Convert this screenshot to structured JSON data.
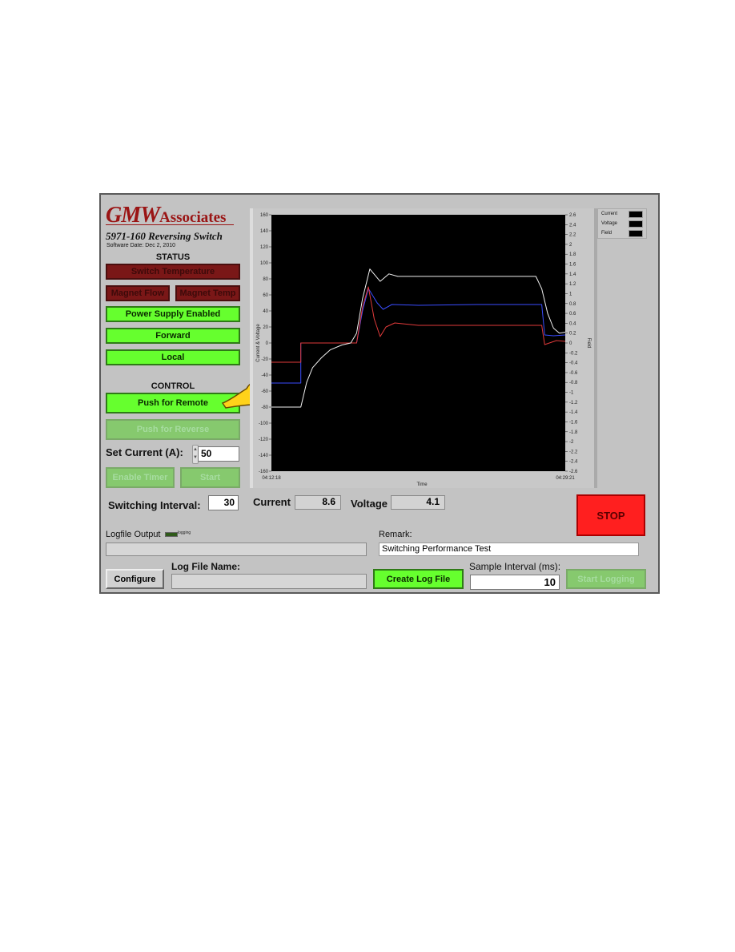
{
  "header": {
    "brand_main": "GMW",
    "brand_suffix": "Associates",
    "product_title": "5971-160 Reversing Switch",
    "software_date": "Software Date: Dec 2, 2010"
  },
  "status": {
    "title": "STATUS",
    "indicators": [
      {
        "label": "Switch Temperature",
        "state": "off"
      },
      {
        "label": "Magnet Flow",
        "state": "off"
      },
      {
        "label": "Magnet Temp",
        "state": "off"
      },
      {
        "label": "Power Supply Enabled",
        "state": "on"
      },
      {
        "label": "Forward",
        "state": "on"
      },
      {
        "label": "Local",
        "state": "on"
      }
    ]
  },
  "control": {
    "title": "CONTROL",
    "push_remote_label": "Push for Remote",
    "push_reverse_label": "Push for Reverse",
    "set_current_label": "Set Current (A):",
    "set_current_value": "50",
    "enable_timer_label": "Enable Timer",
    "start_label": "Start",
    "switching_interval_label": "Switching Interval:",
    "switching_interval_value": "30"
  },
  "readouts": {
    "current_label": "Current",
    "current_value": "8.6",
    "voltage_label": "Voltage",
    "voltage_value": "4.1"
  },
  "stop_label": "STOP",
  "logging": {
    "logfile_output_label": "Logfile Output",
    "logging_led_label": "logging",
    "logfile_output_value": "",
    "configure_label": "Configure",
    "log_file_name_label": "Log File Name:",
    "log_file_name_value": "",
    "remark_label": "Remark:",
    "remark_value": "Switching Performance Test",
    "create_log_label": "Create Log File",
    "sample_interval_label": "Sample Interval (ms):",
    "sample_interval_value": "10",
    "start_logging_label": "Start Logging"
  },
  "colors": {
    "led_on": "#66ff2e",
    "led_off": "#7a1717",
    "stop": "#ff1f1f",
    "current_trace": "#3a4dff",
    "voltage_trace": "#e03a3a",
    "field_trace": "#f0f0f0"
  },
  "chart_data": {
    "type": "line",
    "title": "",
    "xlabel": "Time",
    "ylabel": "Current & Voltage",
    "y2label": "Field",
    "x_start_label": "04:12:18",
    "x_end_label": "04:29:21",
    "xlim": [
      0,
      1
    ],
    "ylim": [
      -160,
      160
    ],
    "y2lim": [
      -2.6,
      2.6
    ],
    "yticks": [
      160,
      140,
      120,
      100,
      80,
      60,
      40,
      20,
      0,
      -20,
      -40,
      -60,
      -80,
      -100,
      -120,
      -140,
      -160
    ],
    "y2ticks": [
      2.6,
      2.4,
      2.2,
      2,
      1.8,
      1.6,
      1.4,
      1.2,
      1,
      0.8,
      0.6,
      0.4,
      0.2,
      0,
      -0.2,
      -0.4,
      -0.6,
      -0.8,
      -1,
      -1.2,
      -1.4,
      -1.6,
      -1.8,
      -2,
      -2.2,
      -2.4,
      -2.6
    ],
    "legend": [
      "Current",
      "Voltage",
      "Field"
    ],
    "legend_position": "top-right-outside",
    "grid": false,
    "series": [
      {
        "name": "Current",
        "axis": "left",
        "x": [
          0,
          0.1,
          0.1,
          0.27,
          0.29,
          0.31,
          0.33,
          0.36,
          0.38,
          0.41,
          0.5,
          0.7,
          0.9,
          0.92,
          0.93,
          0.96,
          1.0
        ],
        "y": [
          -50,
          -50,
          0,
          0,
          0,
          40,
          68,
          50,
          42,
          48,
          47,
          48,
          48,
          48,
          10,
          9,
          10
        ]
      },
      {
        "name": "Voltage",
        "axis": "left",
        "x": [
          0,
          0.1,
          0.1,
          0.27,
          0.29,
          0.31,
          0.33,
          0.35,
          0.37,
          0.39,
          0.42,
          0.5,
          0.7,
          0.9,
          0.92,
          0.93,
          0.97,
          1.0
        ],
        "y": [
          -24,
          -24,
          0,
          0,
          0,
          45,
          70,
          30,
          8,
          20,
          25,
          22,
          22,
          22,
          22,
          -2,
          3,
          2
        ]
      },
      {
        "name": "Field",
        "axis": "right",
        "x": [
          0,
          0.1,
          0.12,
          0.14,
          0.17,
          0.2,
          0.24,
          0.27,
          0.29,
          0.31,
          0.335,
          0.37,
          0.4,
          0.43,
          0.5,
          0.7,
          0.9,
          0.92,
          0.94,
          0.96,
          0.98,
          1.0
        ],
        "y": [
          -1.3,
          -1.3,
          -0.8,
          -0.5,
          -0.3,
          -0.14,
          -0.04,
          0,
          0.2,
          0.9,
          1.5,
          1.25,
          1.4,
          1.35,
          1.35,
          1.35,
          1.35,
          1.1,
          0.6,
          0.3,
          0.2,
          0.22
        ]
      }
    ]
  }
}
